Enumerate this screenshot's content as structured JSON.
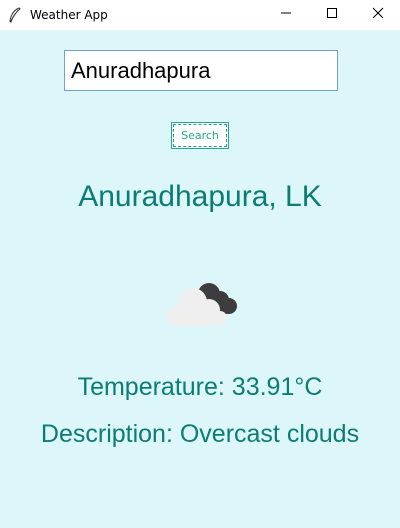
{
  "window": {
    "title": "Weather App",
    "app_icon": "feather-icon",
    "controls": [
      "minimize-icon",
      "maximize-icon",
      "close-icon"
    ]
  },
  "search": {
    "value": "Anuradhapura",
    "button_label": "Search"
  },
  "weather": {
    "location": "Anuradhapura, LK",
    "icon": "overcast-clouds-icon",
    "temperature": "Temperature: 33.91°C",
    "description": "Description: Overcast clouds"
  },
  "colors": {
    "background": "#ddf6f9",
    "accent": "#0b7d73",
    "button": "#24a58f"
  }
}
